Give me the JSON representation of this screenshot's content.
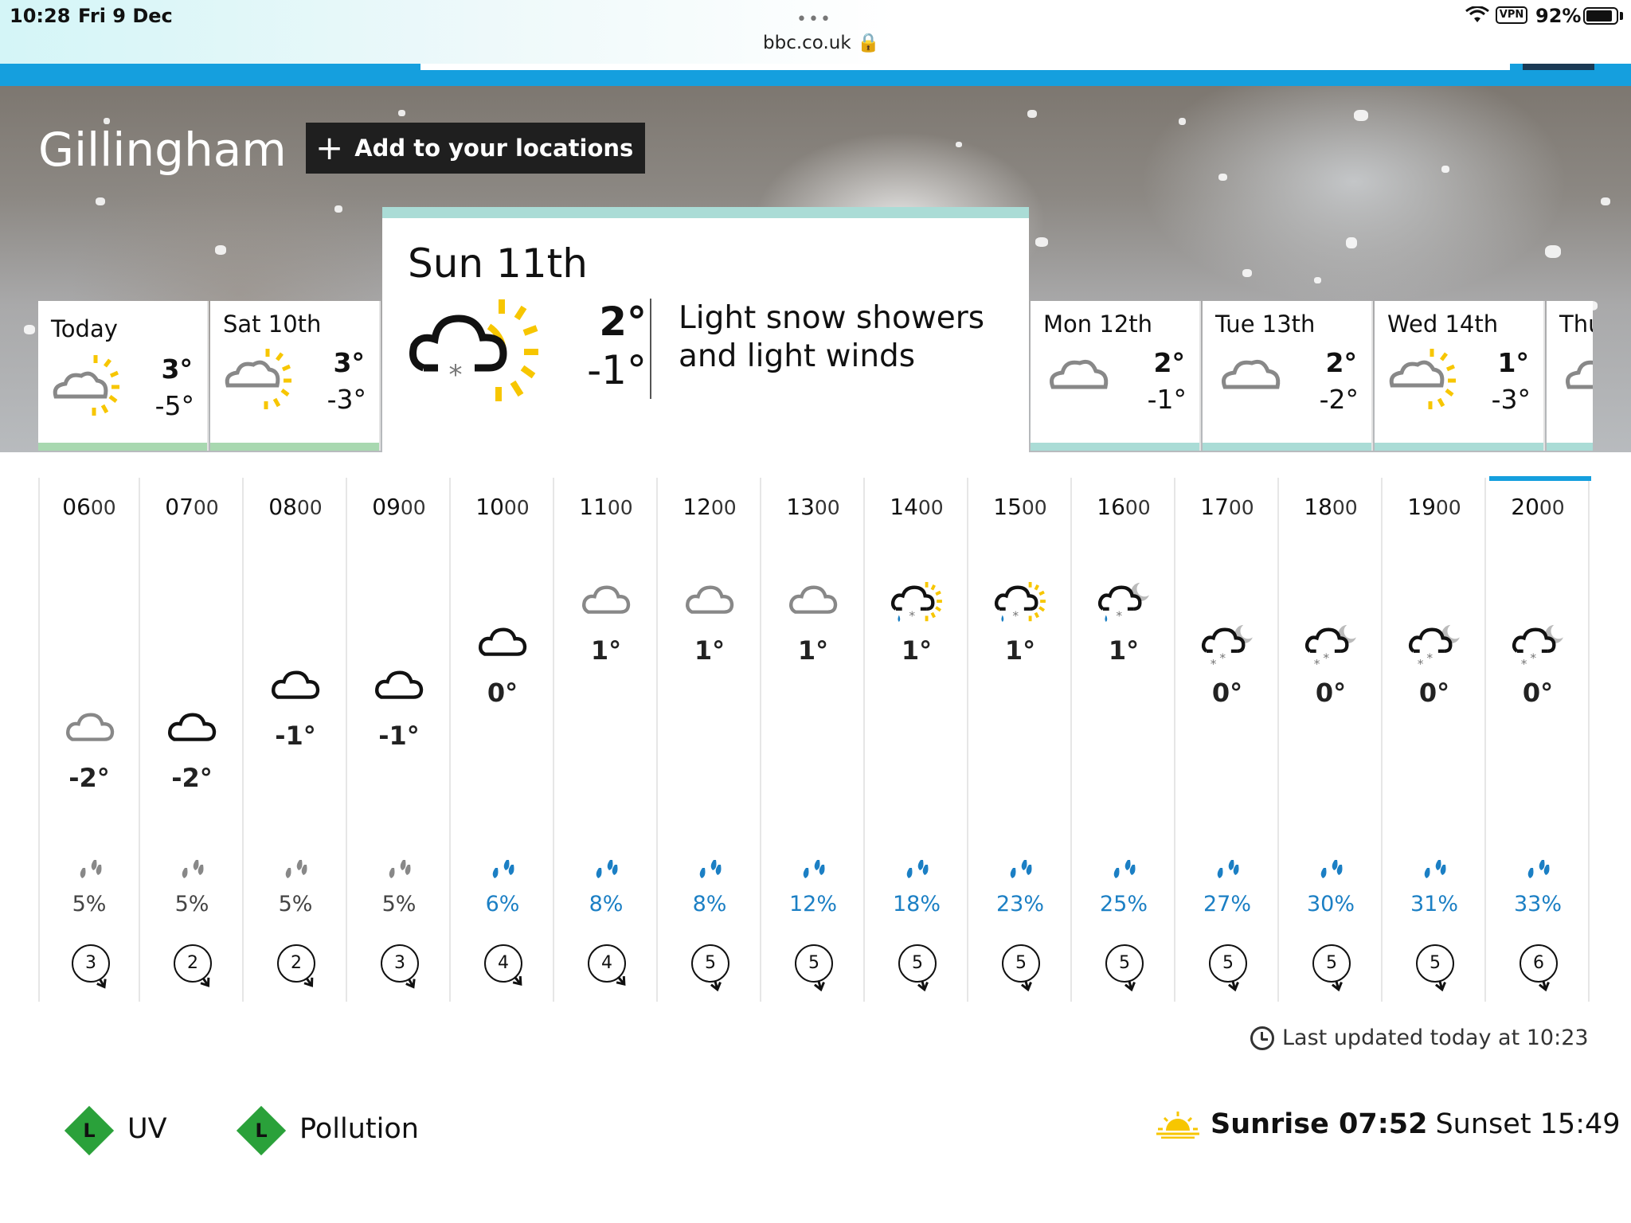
{
  "status_bar": {
    "time": "10:28",
    "date": "Fri 9 Dec",
    "url": "bbc.co.uk",
    "vpn": "VPN",
    "battery": "92%",
    "dots": "•••"
  },
  "header": {
    "location": "Gillingham",
    "add_button": "Add to your locations",
    "add_symbol": "+"
  },
  "days": [
    {
      "name": "Today",
      "date": "",
      "max": "3°",
      "min": "-5°",
      "icon": "sunny-intervals-icon",
      "bar_color": "#a8d8b0"
    },
    {
      "name": "Sat",
      "date": "10th",
      "max": "3°",
      "min": "-3°",
      "icon": "sunny-intervals-light-cloud-icon",
      "bar_color": "#a8d8b0"
    },
    {
      "name": "Mon",
      "date": "12th",
      "max": "2°",
      "min": "-1°",
      "icon": "light-cloud-icon",
      "bar_color": "#aadcd6"
    },
    {
      "name": "Tue",
      "date": "13th",
      "max": "2°",
      "min": "-2°",
      "icon": "light-cloud-icon",
      "bar_color": "#aadcd6"
    },
    {
      "name": "Wed",
      "date": "14th",
      "max": "1°",
      "min": "-3°",
      "icon": "sunny-intervals-light-cloud-icon",
      "bar_color": "#aadcd6"
    },
    {
      "name": "Thu",
      "date": "",
      "max": "",
      "min": "",
      "icon": "light-cloud-icon",
      "bar_color": "#aadcd6"
    }
  ],
  "selected_day": {
    "name": "Sun",
    "date": "11th",
    "max": "2°",
    "min": "-1°",
    "description": "Light snow showers and light winds",
    "icon": "light-snow-shower-day-icon",
    "accent": "#aadcd6"
  },
  "hours": [
    {
      "time_big": "06",
      "time_small": "00",
      "temp": "-2°",
      "icon": "light-cloud-icon",
      "precip": "5%",
      "wind": "3"
    },
    {
      "time_big": "07",
      "time_small": "00",
      "temp": "-2°",
      "icon": "thick-cloud-icon",
      "precip": "5%",
      "wind": "2"
    },
    {
      "time_big": "08",
      "time_small": "00",
      "temp": "-1°",
      "icon": "thick-cloud-icon",
      "precip": "5%",
      "wind": "2"
    },
    {
      "time_big": "09",
      "time_small": "00",
      "temp": "-1°",
      "icon": "thick-cloud-icon",
      "precip": "5%",
      "wind": "3"
    },
    {
      "time_big": "10",
      "time_small": "00",
      "temp": "0°",
      "icon": "thick-cloud-icon",
      "precip": "6%",
      "wind": "4"
    },
    {
      "time_big": "11",
      "time_small": "00",
      "temp": "1°",
      "icon": "light-cloud-icon",
      "precip": "8%",
      "wind": "4"
    },
    {
      "time_big": "12",
      "time_small": "00",
      "temp": "1°",
      "icon": "light-cloud-icon",
      "precip": "8%",
      "wind": "5"
    },
    {
      "time_big": "13",
      "time_small": "00",
      "temp": "1°",
      "icon": "light-cloud-icon",
      "precip": "12%",
      "wind": "5"
    },
    {
      "time_big": "14",
      "time_small": "00",
      "temp": "1°",
      "icon": "sleet-shower-day-icon",
      "precip": "18%",
      "wind": "5"
    },
    {
      "time_big": "15",
      "time_small": "00",
      "temp": "1°",
      "icon": "sleet-shower-day-icon",
      "precip": "23%",
      "wind": "5"
    },
    {
      "time_big": "16",
      "time_small": "00",
      "temp": "1°",
      "icon": "sleet-shower-night-icon",
      "precip": "25%",
      "wind": "5"
    },
    {
      "time_big": "17",
      "time_small": "00",
      "temp": "0°",
      "icon": "light-snow-shower-night-icon",
      "precip": "27%",
      "wind": "5"
    },
    {
      "time_big": "18",
      "time_small": "00",
      "temp": "0°",
      "icon": "light-snow-shower-night-icon",
      "precip": "30%",
      "wind": "5"
    },
    {
      "time_big": "19",
      "time_small": "00",
      "temp": "0°",
      "icon": "light-snow-shower-night-icon",
      "precip": "31%",
      "wind": "5"
    },
    {
      "time_big": "20",
      "time_small": "00",
      "temp": "0°",
      "icon": "light-snow-shower-night-icon",
      "precip": "33%",
      "wind": "6"
    }
  ],
  "footer": {
    "last_updated": "Last updated today at 10:23",
    "uv_level": "L",
    "uv_label": "UV",
    "pollution_level": "L",
    "pollution_label": "Pollution",
    "sunrise": "Sunrise 07:52",
    "sunset": "Sunset 15:49"
  },
  "colors": {
    "accent_blue": "#159fde",
    "precip_blue": "#1b7fc4",
    "sun_yellow": "#f7c600",
    "low_green": "#2aa13a"
  }
}
